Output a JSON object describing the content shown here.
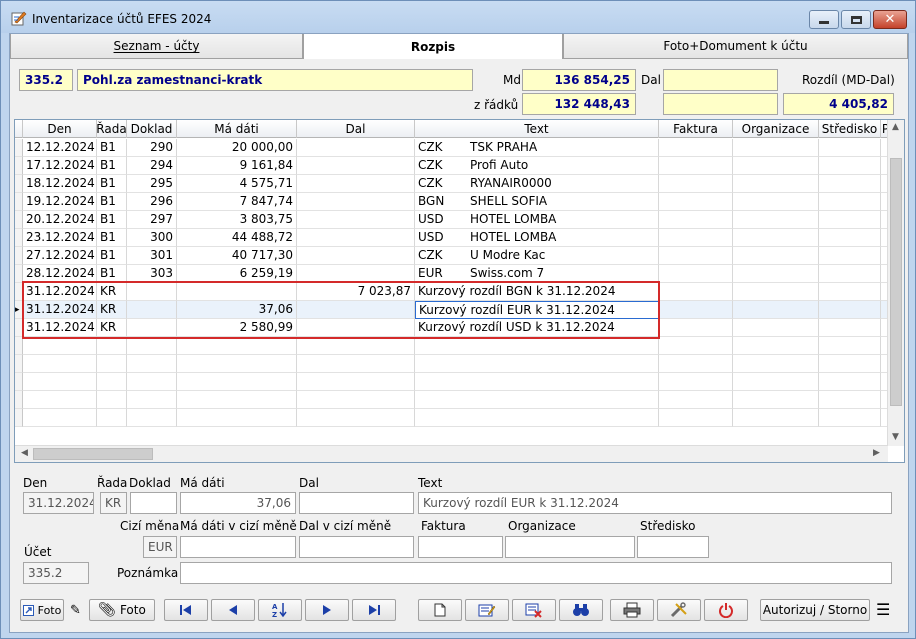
{
  "window": {
    "title": "Inventarizace účtů EFES 2024"
  },
  "tabs": [
    {
      "label": "Seznam - účty"
    },
    {
      "label": "Rozpis"
    },
    {
      "label": "Foto+Domument k účtu"
    }
  ],
  "header": {
    "account_code": "335.2",
    "account_name": "Pohl.za zamestnanci-kratk",
    "md_label": "Md",
    "md_value": "136 854,25",
    "dal_label": "Dal",
    "dal_value": "",
    "rozdil_label": "Rozdíl (MD-Dal)",
    "zradku_label": "z řádků",
    "zradku_md": "132 448,43",
    "zradku_dal": "",
    "rozdil_value": "4 405,82"
  },
  "grid": {
    "columns": [
      "Den",
      "Řada",
      "Doklad",
      "Má dáti",
      "Dal",
      "Text",
      "Faktura",
      "Organizace",
      "Středisko",
      "P"
    ],
    "rows": [
      [
        "12.12.2024",
        "B1",
        "290",
        "20 000,00",
        "",
        "CZK",
        "TSK PRAHA"
      ],
      [
        "17.12.2024",
        "B1",
        "294",
        "9 161,84",
        "",
        "CZK",
        "Profi Auto"
      ],
      [
        "18.12.2024",
        "B1",
        "295",
        "4 575,71",
        "",
        "CZK",
        "RYANAIR0000"
      ],
      [
        "19.12.2024",
        "B1",
        "296",
        "7 847,74",
        "",
        "BGN",
        "SHELL SOFIA"
      ],
      [
        "20.12.2024",
        "B1",
        "297",
        "3 803,75",
        "",
        "USD",
        "HOTEL LOMBA"
      ],
      [
        "23.12.2024",
        "B1",
        "300",
        "44 488,72",
        "",
        "USD",
        "HOTEL LOMBA"
      ],
      [
        "27.12.2024",
        "B1",
        "301",
        "40 717,30",
        "",
        "CZK",
        "U Modre Kac"
      ],
      [
        "28.12.2024",
        "B1",
        "303",
        "6 259,19",
        "",
        "EUR",
        "Swiss.com 7"
      ],
      [
        "31.12.2024",
        "KR",
        "",
        "",
        "7 023,87",
        "Kurzový rozdíl BGN k 31.12.2024",
        ""
      ],
      [
        "31.12.2024",
        "KR",
        "",
        "37,06",
        "",
        "Kurzový rozdíl EUR k 31.12.2024",
        ""
      ],
      [
        "31.12.2024",
        "KR",
        "",
        "2 580,99",
        "",
        "Kurzový rozdíl USD k 31.12.2024",
        ""
      ]
    ]
  },
  "detail": {
    "den_label": "Den",
    "den_value": "31.12.2024",
    "rada_label": "Řada",
    "rada_value": "KR",
    "doklad_label": "Doklad",
    "doklad_value": "",
    "madati_label": "Má dáti",
    "madati_value": "37,06",
    "dal_label": "Dal",
    "dal_value": "",
    "text_label": "Text",
    "text_value": "Kurzový rozdíl EUR k 31.12.2024",
    "cizi_mena_label": "Cizí měna",
    "cizi_mena_value": "EUR",
    "madati_cizi_label": "Má dáti v cizí měně",
    "madati_cizi_value": "",
    "dal_cizi_label": "Dal v cizí měně",
    "dal_cizi_value": "",
    "faktura_label": "Faktura",
    "faktura_value": "",
    "organizace_label": "Organizace",
    "organizace_value": "",
    "stredisko_label": "Středisko",
    "stredisko_value": "",
    "ucet_label": "Účet",
    "ucet_value": "335.2",
    "poznamka_label": "Poznámka",
    "poznamka_value": ""
  },
  "toolbar": {
    "foto_small_label": "Foto",
    "foto_label": "Foto",
    "autorizuj_label": "Autorizuj / Storno"
  }
}
